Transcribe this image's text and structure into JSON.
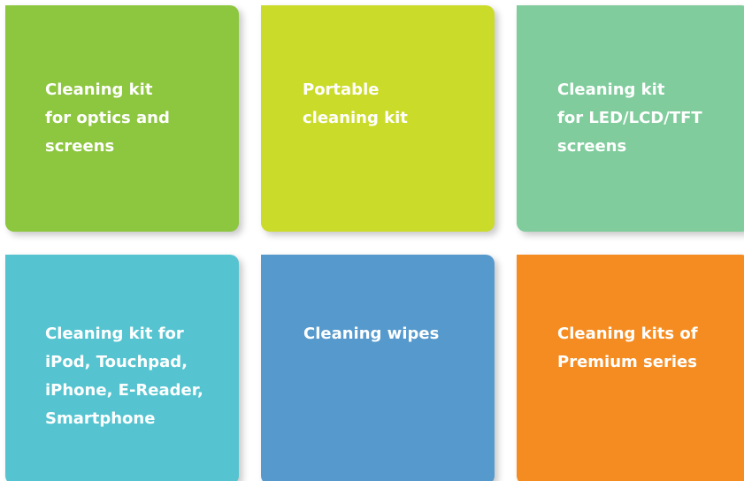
{
  "tiles": [
    {
      "label": "Cleaning kit\nfor optics and\nscreens",
      "color": "#8dc63f"
    },
    {
      "label": "Portable\ncleaning kit",
      "color": "#cbdb2a"
    },
    {
      "label": "Cleaning kit\nfor LED/LCD/TFT\nscreens",
      "color": "#80cc9c"
    },
    {
      "label": "Cleaning kit for\niPod, Touchpad,\niPhone, E-Reader,\nSmartphone",
      "color": "#55c4d0"
    },
    {
      "label": "Cleaning wipes",
      "color": "#5699cc"
    },
    {
      "label": "Cleaning kits of\nPremium series",
      "color": "#f58c22"
    }
  ]
}
